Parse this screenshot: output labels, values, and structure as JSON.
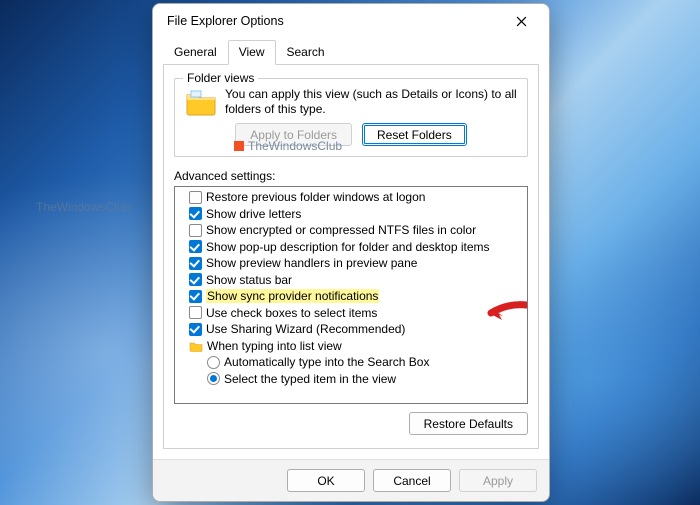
{
  "window": {
    "title": "File Explorer Options"
  },
  "tabs": {
    "general": "General",
    "view": "View",
    "search": "Search"
  },
  "folderViews": {
    "legend": "Folder views",
    "text": "You can apply this view (such as Details or Icons) to all folders of this type.",
    "applyBtn": "Apply to Folders",
    "resetBtn": "Reset Folders"
  },
  "advanced": {
    "label": "Advanced settings:",
    "items": [
      {
        "label": "Restore previous folder windows at logon"
      },
      {
        "label": "Show drive letters"
      },
      {
        "label": "Show encrypted or compressed NTFS files in color"
      },
      {
        "label": "Show pop-up description for folder and desktop items"
      },
      {
        "label": "Show preview handlers in preview pane"
      },
      {
        "label": "Show status bar"
      },
      {
        "label": "Show sync provider notifications"
      },
      {
        "label": "Use check boxes to select items"
      },
      {
        "label": "Use Sharing Wizard (Recommended)"
      },
      {
        "label": "When typing into list view"
      },
      {
        "label": "Automatically type into the Search Box"
      },
      {
        "label": "Select the typed item in the view"
      }
    ]
  },
  "restoreDefaults": "Restore Defaults",
  "footer": {
    "ok": "OK",
    "cancel": "Cancel",
    "apply": "Apply"
  },
  "watermark": "TheWindowsClub",
  "sideWatermark": "TheWindowsClub"
}
